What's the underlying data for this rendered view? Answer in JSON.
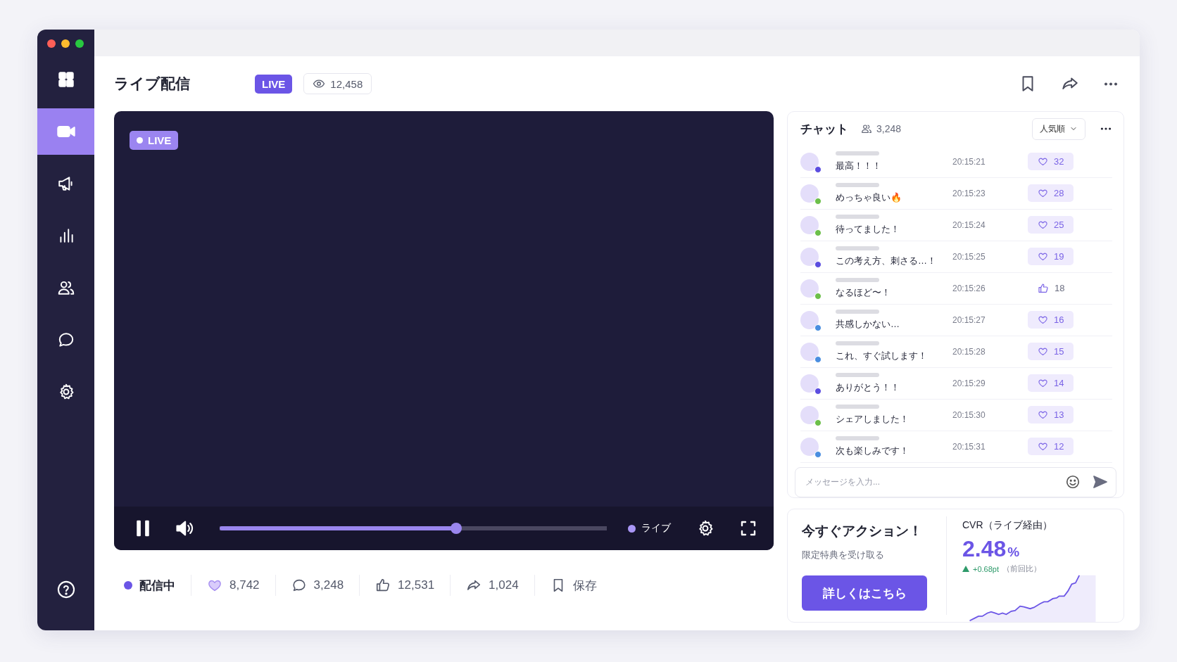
{
  "sidebar": {
    "items": [
      {
        "kind": "grid",
        "selected": false
      },
      {
        "kind": "video",
        "selected": true
      },
      {
        "kind": "megaphone",
        "selected": false
      },
      {
        "kind": "chart",
        "selected": false
      },
      {
        "kind": "users",
        "selected": false
      },
      {
        "kind": "chat",
        "selected": false
      },
      {
        "kind": "gear",
        "selected": false
      }
    ]
  },
  "header": {
    "title": "ライブ配信",
    "badge": "LIVE",
    "viewers": "12,458"
  },
  "video": {
    "badge": "LIVE",
    "controls": {
      "playing": true,
      "level": 0.61,
      "live_label": "ライブ"
    }
  },
  "stats": [
    {
      "kind": "live",
      "label": "配信中"
    },
    {
      "kind": "heart",
      "label": "8,742"
    },
    {
      "kind": "comment",
      "label": "3,248"
    },
    {
      "kind": "thumb",
      "label": "12,531"
    },
    {
      "kind": "share",
      "label": "1,024"
    },
    {
      "kind": "bookmark",
      "label": "保存"
    }
  ],
  "chat": {
    "title": "チャット",
    "count": "3,248",
    "sort": "人気順",
    "messages": [
      {
        "text": "最高！！！",
        "time": "20:15:21",
        "kind": "heart",
        "likes": "32",
        "color": "#5b4de0"
      },
      {
        "text": "めっちゃ良い🔥",
        "time": "20:15:23",
        "kind": "heart",
        "likes": "28",
        "color": "#6cbf4a"
      },
      {
        "text": "待ってました！",
        "time": "20:15:24",
        "kind": "heart",
        "likes": "25",
        "color": "#6cbf4a"
      },
      {
        "text": "この考え方、刺さる…！",
        "time": "20:15:25",
        "kind": "heart",
        "likes": "19",
        "color": "#5b4de0"
      },
      {
        "text": "なるほど〜！",
        "time": "20:15:26",
        "kind": "thumb",
        "likes": "18",
        "color": "#6cbf4a"
      },
      {
        "text": "共感しかない…",
        "time": "20:15:27",
        "kind": "heart",
        "likes": "16",
        "color": "#4a8ee0"
      },
      {
        "text": "これ、すぐ試します！",
        "time": "20:15:28",
        "kind": "heart",
        "likes": "15",
        "color": "#4a8ee0"
      },
      {
        "text": "ありがとう！！",
        "time": "20:15:29",
        "kind": "heart",
        "likes": "14",
        "color": "#5b4de0"
      },
      {
        "text": "シェアしました！",
        "time": "20:15:30",
        "kind": "heart",
        "likes": "13",
        "color": "#6cbf4a"
      },
      {
        "text": "次も楽しみです！",
        "time": "20:15:31",
        "kind": "heart",
        "likes": "12",
        "color": "#4a8ee0"
      }
    ],
    "input": {
      "placeholder": "メッセージを入力..."
    }
  },
  "action": {
    "title": "今すぐアクション！",
    "subtitle": "限定特典を受け取る",
    "button": "詳しくはこちら"
  },
  "cvr": {
    "title": "CVR（ライブ経由）",
    "value": "2.48",
    "unit": "%",
    "change": "+0.68pt",
    "change_note": "（前回比）"
  }
}
